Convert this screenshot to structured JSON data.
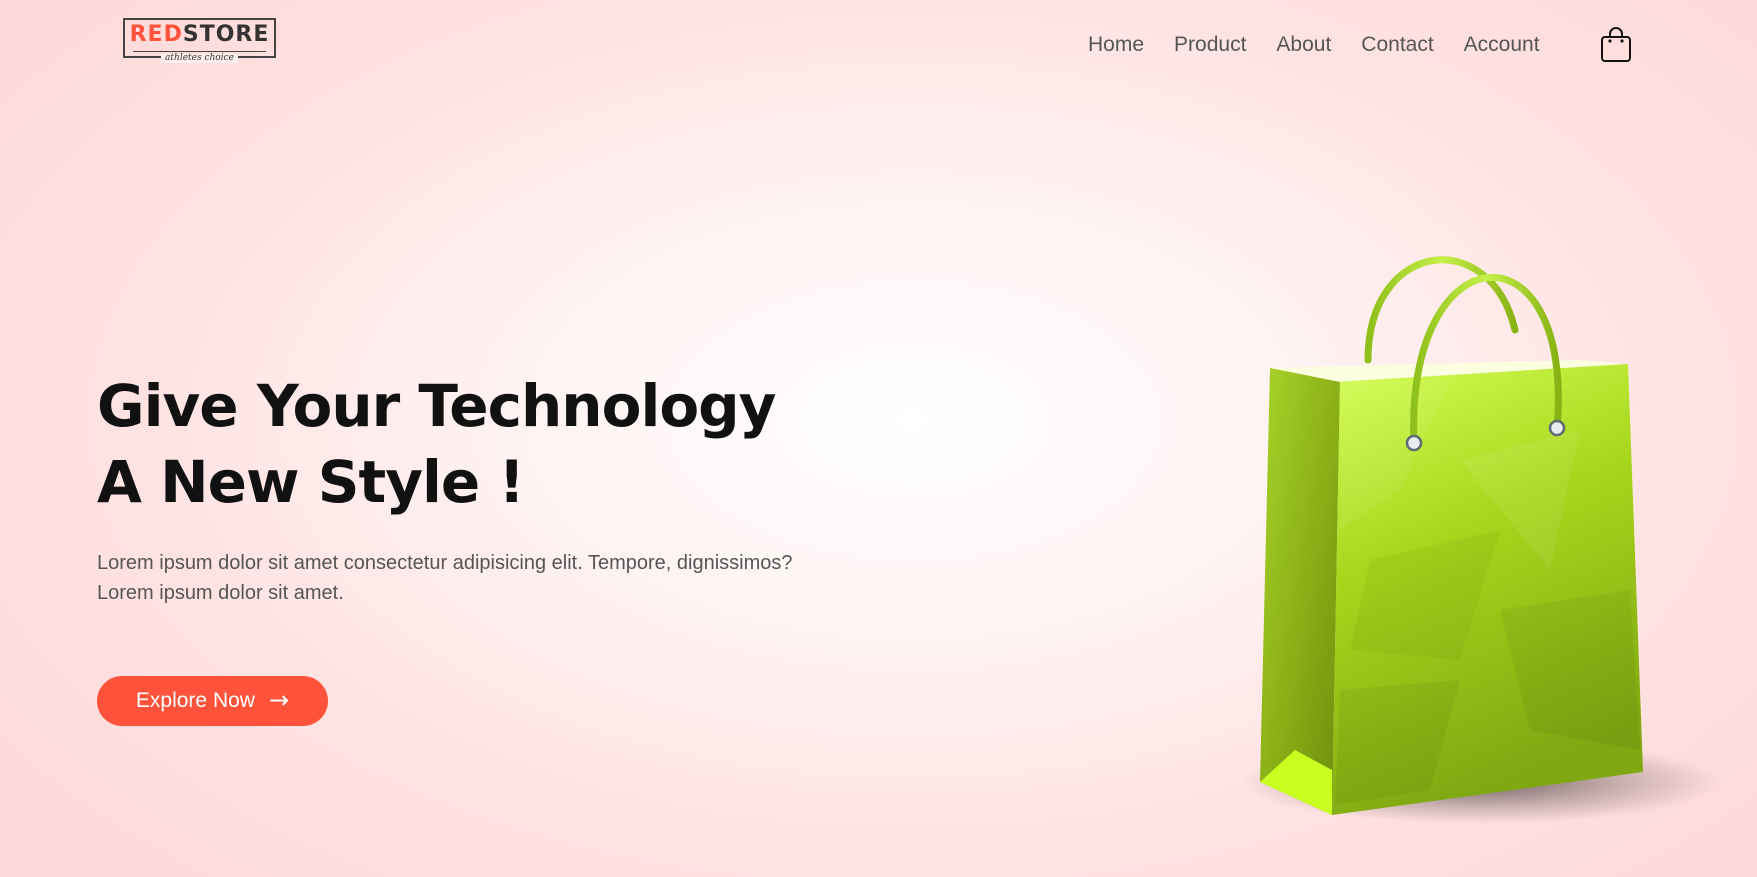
{
  "header": {
    "logo": {
      "part_red": "RED",
      "part_dark": "STORE",
      "tagline": "athletes choice"
    },
    "nav": [
      {
        "label": "Home"
      },
      {
        "label": "Product"
      },
      {
        "label": "About"
      },
      {
        "label": "Contact"
      },
      {
        "label": "Account"
      }
    ],
    "cart_icon": "shopping-bag-icon"
  },
  "hero": {
    "title_line1": "Give Your Technology",
    "title_line2": "A New Style !",
    "text_line1": "Lorem ipsum dolor sit amet consectetur adipisicing elit. Tempore, dignissimos?",
    "text_line2": "Lorem ipsum dolor sit amet.",
    "button_label": "Explore Now",
    "button_arrow": "→",
    "image_icon": "green-shopping-bag-image"
  },
  "colors": {
    "accent": "#ff523b",
    "bag_green": "#b5e61d",
    "text_dark": "#111111",
    "text_muted": "#555555"
  }
}
